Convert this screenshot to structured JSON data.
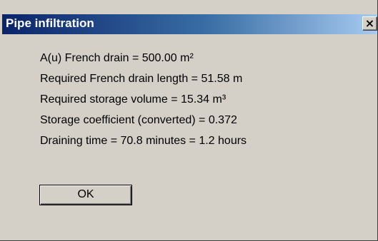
{
  "window": {
    "title": "Pipe infiltration",
    "close_label": "×"
  },
  "results": {
    "lines": [
      "A(u) French drain = 500.00 m²",
      "Required French drain length = 51.58 m",
      "Required storage volume = 15.34 m³",
      "Storage coefficient (converted) = 0.372",
      "Draining time = 70.8 minutes = 1.2 hours"
    ]
  },
  "buttons": {
    "ok_label": "OK"
  },
  "colors": {
    "title_bar_start": "#0a246a",
    "title_bar_end": "#a6caf0",
    "dialog_background": "#d4d0c8"
  }
}
